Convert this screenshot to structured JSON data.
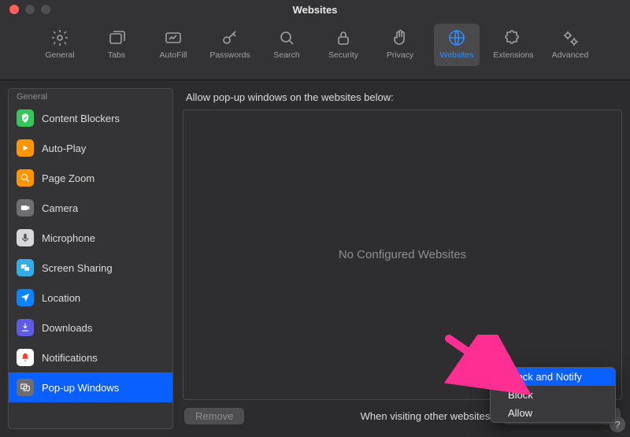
{
  "window": {
    "title": "Websites"
  },
  "toolbar": {
    "items": [
      {
        "id": "general",
        "label": "General",
        "icon": "gear"
      },
      {
        "id": "tabs",
        "label": "Tabs",
        "icon": "tabs"
      },
      {
        "id": "autofill",
        "label": "AutoFill",
        "icon": "autofill"
      },
      {
        "id": "passwords",
        "label": "Passwords",
        "icon": "key"
      },
      {
        "id": "search",
        "label": "Search",
        "icon": "search"
      },
      {
        "id": "security",
        "label": "Security",
        "icon": "lock"
      },
      {
        "id": "privacy",
        "label": "Privacy",
        "icon": "hand"
      },
      {
        "id": "websites",
        "label": "Websites",
        "icon": "globe",
        "selected": true
      },
      {
        "id": "extensions",
        "label": "Extensions",
        "icon": "puzzle"
      },
      {
        "id": "advanced",
        "label": "Advanced",
        "icon": "gears"
      }
    ]
  },
  "sidebar": {
    "header": "General",
    "items": [
      {
        "label": "Content Blockers",
        "icon": "shield",
        "bg": "#34c759"
      },
      {
        "label": "Auto-Play",
        "icon": "play",
        "bg": "#ff9500"
      },
      {
        "label": "Page Zoom",
        "icon": "zoom",
        "bg": "#ff9500"
      },
      {
        "label": "Camera",
        "icon": "camera",
        "bg": "#6e6e72"
      },
      {
        "label": "Microphone",
        "icon": "mic",
        "bg": "#d8d8da"
      },
      {
        "label": "Screen Sharing",
        "icon": "screens",
        "bg": "#32ade6"
      },
      {
        "label": "Location",
        "icon": "location",
        "bg": "#0a84ff"
      },
      {
        "label": "Downloads",
        "icon": "download",
        "bg": "#5e5ce6"
      },
      {
        "label": "Notifications",
        "icon": "bell",
        "bg": "#ffffff"
      },
      {
        "label": "Pop-up Windows",
        "icon": "windows",
        "bg": "#6e6e72",
        "selected": true
      }
    ]
  },
  "content": {
    "heading": "Allow pop-up windows on the websites below:",
    "empty_text": "No Configured Websites",
    "remove_label": "Remove",
    "footer_label": "When visiting other websites:",
    "selected_option": "Block and Notify"
  },
  "menu": {
    "options": [
      {
        "label": "Block and Notify",
        "selected": true
      },
      {
        "label": "Block"
      },
      {
        "label": "Allow"
      }
    ]
  },
  "help_label": "?"
}
